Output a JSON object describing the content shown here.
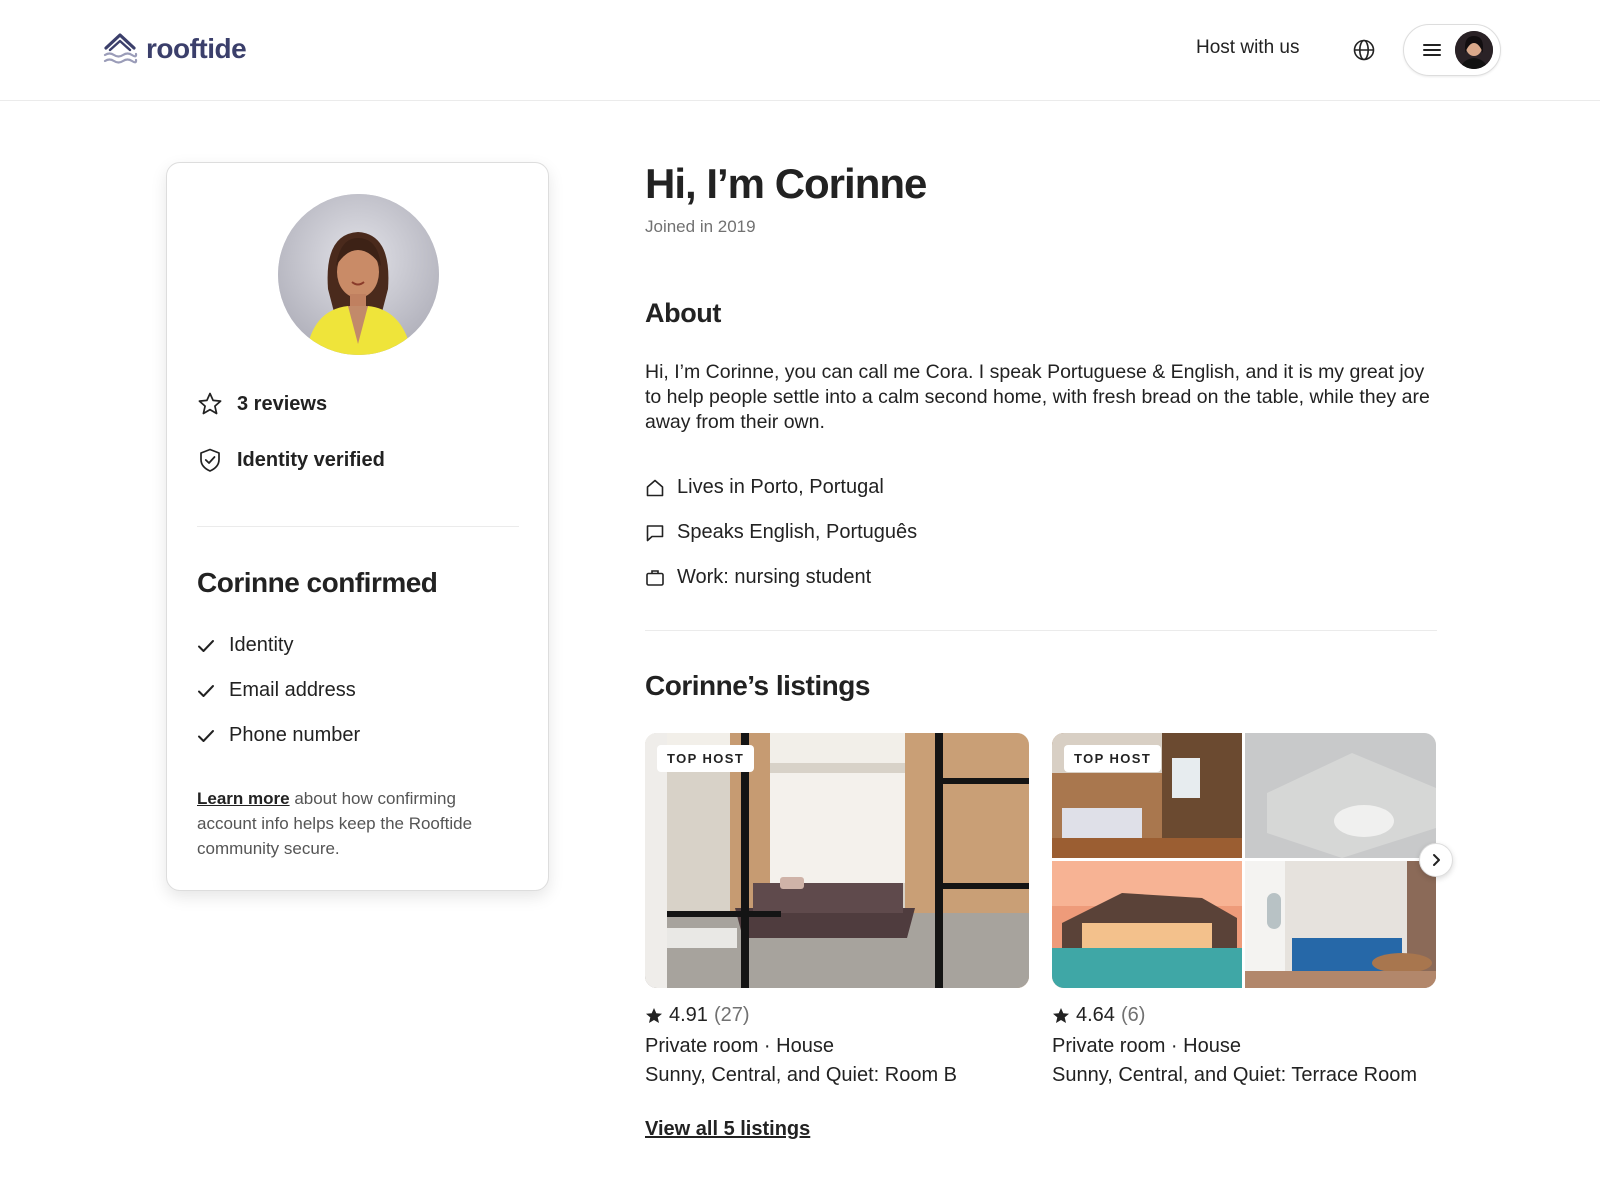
{
  "header": {
    "logo_text": "rooftide",
    "host_link": "Host with us",
    "brand_color": "#3b3f6b"
  },
  "profile_card": {
    "reviews": "3 reviews",
    "identity_verified": "Identity verified",
    "confirmed_title": "Corinne confirmed",
    "confirmed_items": [
      "Identity",
      "Email address",
      "Phone number"
    ],
    "learn_more_link": "Learn more",
    "learn_more_text": " about how confirming account info helps keep the Rooftide community secure."
  },
  "main": {
    "title": "Hi, I’m Corinne",
    "joined": "Joined in 2019",
    "about_title": "About",
    "about_text": "Hi, I’m Corinne, you can call me Cora. I speak Portuguese & English, and it is my great joy to help people settle into a calm second home, with fresh bread on the table, while they are away from their own.",
    "lives_in": "Lives in Porto, Portugal",
    "speaks": "Speaks English, Português",
    "work": "Work: nursing student",
    "listings_title": "Corinne’s listings",
    "view_all": "View all 5 listings"
  },
  "listings": [
    {
      "badge": "TOP HOST",
      "rating": "4.91",
      "reviews": "(27)",
      "type": "Private room · House",
      "name": "Sunny, Central, and Quiet: Room B"
    },
    {
      "badge": "TOP HOST",
      "rating": "4.64",
      "reviews": "(6)",
      "type": "Private room · House",
      "name": "Sunny, Central, and Quiet: Terrace Room"
    }
  ],
  "icons": {
    "star": "star-outline-icon",
    "shield": "shield-check-icon",
    "home": "home-icon",
    "speech": "speech-bubble-icon",
    "briefcase": "briefcase-icon",
    "check": "check-icon",
    "globe": "globe-icon",
    "menu": "menu-icon",
    "chevron": "chevron-right-icon"
  }
}
